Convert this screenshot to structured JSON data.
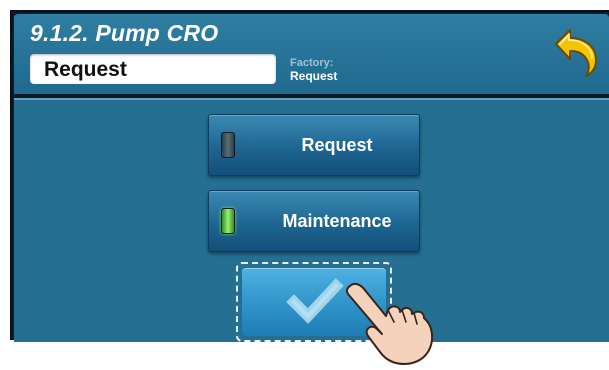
{
  "header": {
    "title": "9.1.2. Pump CRO",
    "value": "Request",
    "factory_label": "Factory:",
    "factory_value": "Request",
    "back_icon": "back-arrow-icon"
  },
  "options": [
    {
      "label": "Request",
      "indicator": "off"
    },
    {
      "label": "Maintenance",
      "indicator": "on"
    }
  ],
  "confirm": {
    "icon": "checkmark-icon"
  },
  "colors": {
    "panel_blue": "#246f92",
    "header_blue": "#2f7ea2",
    "button_blue": "#1e6592",
    "confirm_blue": "#2f93c9",
    "indicator_green": "#7ee05a",
    "back_arrow_yellow": "#f5c400"
  }
}
